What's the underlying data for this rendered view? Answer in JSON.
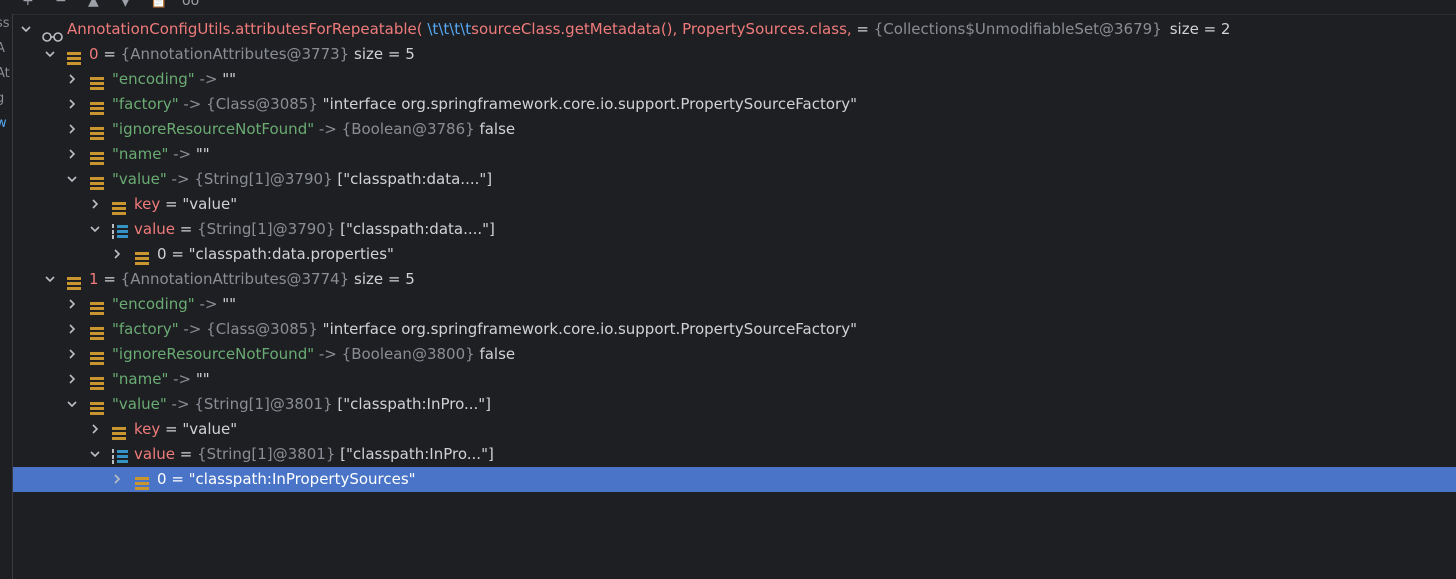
{
  "colors": {
    "background": "#1e1f22",
    "selection": "#4974c7",
    "string": "#6aab73",
    "name": "#f07b7b",
    "gray": "#8a8d94",
    "value": "#d0d2d6",
    "icon": "#c9952f"
  },
  "toolbar": {
    "buttons": [
      "+",
      "−",
      "▲",
      "▼",
      "📋",
      "oo"
    ]
  },
  "gutter": {
    "fragments": [
      "ss",
      "A",
      "At",
      "g",
      "w"
    ]
  },
  "tree": {
    "root": {
      "name": "AnnotationConfigUtils.attributesForRepeatable(",
      "escape": " \\t\\t\\t\\t",
      "name2": "sourceClass.getMetadata(), PropertySources.class,",
      "eq": " = ",
      "type": "{Collections$UnmodifiableSet@3679}",
      "size": "size = 2"
    },
    "rows": [
      {
        "depth": 1,
        "exp": "open",
        "icon": "list",
        "kind": "name",
        "key": "0",
        "eq": " = ",
        "type": "{AnnotationAttributes@3773}",
        "val": "size = 5"
      },
      {
        "depth": 2,
        "exp": "closed",
        "icon": "field",
        "kind": "str",
        "key": "\"encoding\"",
        "eq": " -> ",
        "type": "",
        "val": "\"\""
      },
      {
        "depth": 2,
        "exp": "closed",
        "icon": "field",
        "kind": "str",
        "key": "\"factory\"",
        "eq": " -> ",
        "type": "{Class@3085}",
        "val": "\"interface org.springframework.core.io.support.PropertySourceFactory\""
      },
      {
        "depth": 2,
        "exp": "closed",
        "icon": "field",
        "kind": "str",
        "key": "\"ignoreResourceNotFound\"",
        "eq": " -> ",
        "type": "{Boolean@3786}",
        "val": "false"
      },
      {
        "depth": 2,
        "exp": "closed",
        "icon": "field",
        "kind": "str",
        "key": "\"name\"",
        "eq": " -> ",
        "type": "",
        "val": "\"\""
      },
      {
        "depth": 2,
        "exp": "open",
        "icon": "field",
        "kind": "str",
        "key": "\"value\"",
        "eq": " -> ",
        "type": "{String[1]@3790}",
        "val": "[\"classpath:data....\"]"
      },
      {
        "depth": 3,
        "exp": "closed",
        "icon": "field",
        "kind": "name",
        "key": "key",
        "eq": " = ",
        "type": "",
        "val": "\"value\""
      },
      {
        "depth": 3,
        "exp": "open",
        "icon": "array",
        "kind": "name",
        "key": "value",
        "eq": " = ",
        "type": "{String[1]@3790}",
        "val": "[\"classpath:data....\"]"
      },
      {
        "depth": 4,
        "exp": "closed",
        "icon": "field",
        "kind": "plain",
        "key": "0",
        "eq": " = ",
        "type": "",
        "val": "\"classpath:data.properties\""
      },
      {
        "depth": 1,
        "exp": "open",
        "icon": "list",
        "kind": "name",
        "key": "1",
        "eq": " = ",
        "type": "{AnnotationAttributes@3774}",
        "val": "size = 5"
      },
      {
        "depth": 2,
        "exp": "closed",
        "icon": "field",
        "kind": "str",
        "key": "\"encoding\"",
        "eq": " -> ",
        "type": "",
        "val": "\"\""
      },
      {
        "depth": 2,
        "exp": "closed",
        "icon": "field",
        "kind": "str",
        "key": "\"factory\"",
        "eq": " -> ",
        "type": "{Class@3085}",
        "val": "\"interface org.springframework.core.io.support.PropertySourceFactory\""
      },
      {
        "depth": 2,
        "exp": "closed",
        "icon": "field",
        "kind": "str",
        "key": "\"ignoreResourceNotFound\"",
        "eq": " -> ",
        "type": "{Boolean@3800}",
        "val": "false"
      },
      {
        "depth": 2,
        "exp": "closed",
        "icon": "field",
        "kind": "str",
        "key": "\"name\"",
        "eq": " -> ",
        "type": "",
        "val": "\"\""
      },
      {
        "depth": 2,
        "exp": "open",
        "icon": "field",
        "kind": "str",
        "key": "\"value\"",
        "eq": " -> ",
        "type": "{String[1]@3801}",
        "val": "[\"classpath:InPro...\"]"
      },
      {
        "depth": 3,
        "exp": "closed",
        "icon": "field",
        "kind": "name",
        "key": "key",
        "eq": " = ",
        "type": "",
        "val": "\"value\""
      },
      {
        "depth": 3,
        "exp": "open",
        "icon": "array",
        "kind": "name",
        "key": "value",
        "eq": " = ",
        "type": "{String[1]@3801}",
        "val": "[\"classpath:InPro...\"]"
      },
      {
        "depth": 4,
        "exp": "closed",
        "icon": "field",
        "kind": "plain",
        "key": "0",
        "eq": " = ",
        "type": "",
        "val": "\"classpath:InPropertySources\"",
        "selected": true
      }
    ]
  }
}
